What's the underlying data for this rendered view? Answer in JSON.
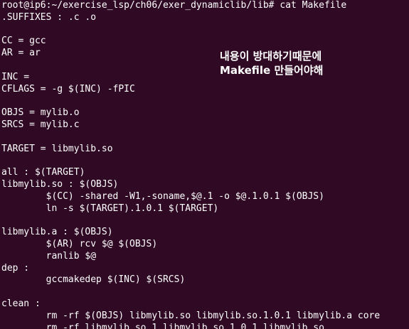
{
  "terminal": {
    "background": "#300a24",
    "foreground": "#ffffff",
    "lines": [
      "root@ip6:~/exercise_lsp/ch06/exer_dynamiclib/lib# cat Makefile",
      ".SUFFIXES : .c .o",
      "",
      "CC = gcc",
      "AR = ar",
      "",
      "INC =",
      "CFLAGS = -g $(INC) -fPIC",
      "",
      "OBJS = mylib.o",
      "SRCS = mylib.c",
      "",
      "TARGET = libmylib.so",
      "",
      "all : $(TARGET)",
      "libmylib.so : $(OBJS)",
      "        $(CC) -shared -W1,-soname,$@.1 -o $@.1.0.1 $(OBJS)",
      "        ln -s $(TARGET).1.0.1 $(TARGET)",
      "",
      "libmylib.a : $(OBJS)",
      "        $(AR) rcv $@ $(OBJS)",
      "        ranlib $@",
      "dep :",
      "        gccmakedep $(INC) $(SRCS)",
      "",
      "clean :",
      "        rm -rf $(OBJS) libmylib.so libmylib.so.1.0.1 libmylib.a core",
      "        rm -rf libmylib.so.1 libmylib.so.1.0.1 libmylib.so"
    ]
  },
  "annotation": {
    "lines": [
      "내용이 방대하기때문에",
      "Makefile 만들어야해"
    ]
  }
}
